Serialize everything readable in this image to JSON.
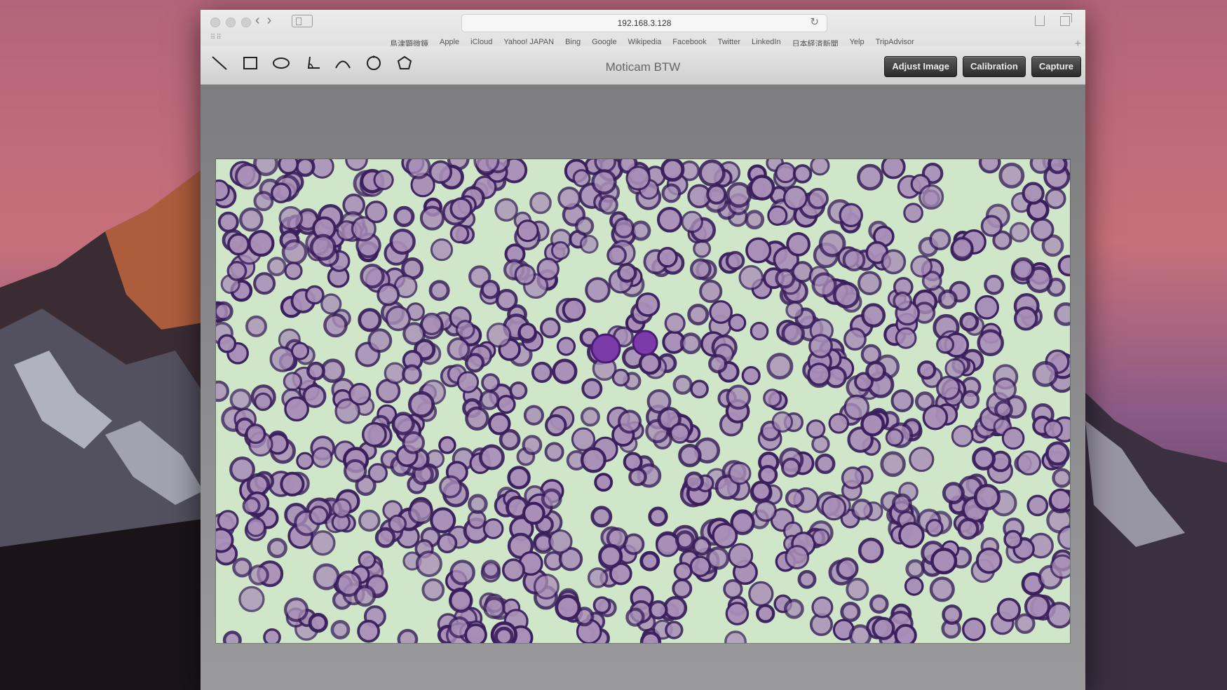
{
  "browser": {
    "url": "192.168.3.128",
    "bookmarks": [
      "島津顕微鏡",
      "Apple",
      "iCloud",
      "Yahoo! JAPAN",
      "Bing",
      "Google",
      "Wikipedia",
      "Facebook",
      "Twitter",
      "LinkedIn",
      "日本経済新聞",
      "Yelp",
      "TripAdvisor"
    ]
  },
  "app": {
    "title": "Moticam BTW",
    "tools": [
      "line-tool",
      "rectangle-tool",
      "ellipse-tool",
      "angle-tool",
      "arc-tool",
      "circle-tool",
      "polygon-tool"
    ],
    "buttons": {
      "adjust_image": "Adjust Image",
      "calibration": "Calibration",
      "capture": "Capture"
    }
  },
  "viewer": {
    "image": "blood-smear-microscope-view",
    "colors": {
      "background": "#cfe7c8",
      "cell_ring": "#3a1f5c",
      "cell_center": "#a98fb8"
    }
  }
}
